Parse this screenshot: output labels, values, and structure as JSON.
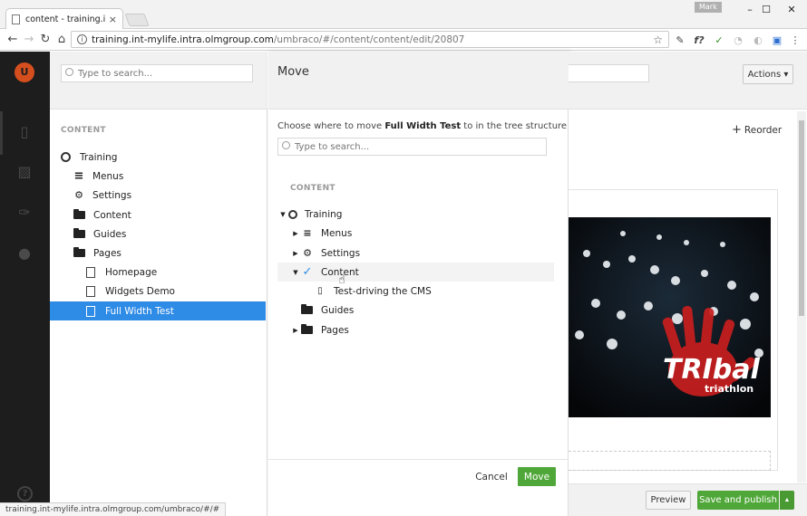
{
  "browser": {
    "tab_title": "content - training.int-my",
    "tab_close": "×",
    "user": "Mark",
    "controls": {
      "minimize": "–",
      "maximize": "☐",
      "close": "✕"
    },
    "nav": {
      "back": "←",
      "forward": "→",
      "reload": "↻",
      "home": "⌂"
    },
    "url_host": "training.int-mylife.intra.olmgroup.com",
    "url_path": "/umbraco/#/content/content/edit/20807",
    "star": "☆",
    "extensions": [
      "✎",
      "f?",
      "✓",
      "◔",
      "◐",
      "▣",
      "⋮"
    ],
    "status_url": "training.int-mylife.intra.olmgroup.com/umbraco/#/#"
  },
  "left_nav": {
    "logo": "U",
    "icons": [
      "content-icon",
      "media-icon",
      "settings-icon",
      "users-icon"
    ],
    "glyphs": [
      "▯",
      "▨",
      "✑",
      "●"
    ],
    "help": "?"
  },
  "tree": {
    "search_placeholder": "Type to search...",
    "section": "CONTENT",
    "items": [
      {
        "label": "Training",
        "icon": "globe"
      },
      {
        "label": "Menus",
        "icon": "menu"
      },
      {
        "label": "Settings",
        "icon": "gear"
      },
      {
        "label": "Content",
        "icon": "folder"
      },
      {
        "label": "Guides",
        "icon": "folder"
      },
      {
        "label": "Pages",
        "icon": "folder"
      },
      {
        "label": "Homepage",
        "icon": "document"
      },
      {
        "label": "Widgets Demo",
        "icon": "document"
      },
      {
        "label": "Full Width Test",
        "icon": "document",
        "active": true
      }
    ]
  },
  "move_dialog": {
    "title": "Move",
    "desc_prefix": "Choose where to move ",
    "desc_node": "Full Width Test",
    "desc_suffix": " to in the tree structure below",
    "search_placeholder": "Type to search...",
    "section": "CONTENT",
    "items": [
      {
        "label": "Training",
        "caret": "▼"
      },
      {
        "label": "Menus",
        "caret": "▶"
      },
      {
        "label": "Settings",
        "caret": "▶"
      },
      {
        "label": "Content",
        "caret": "▼",
        "selected": true
      },
      {
        "label": "Test-driving the CMS",
        "caret": ""
      },
      {
        "label": "Guides",
        "caret": ""
      },
      {
        "label": "Pages",
        "caret": "▶"
      }
    ],
    "cancel_label": "Cancel",
    "move_label": "Move"
  },
  "editor": {
    "actions_label": "Actions ▾",
    "reorder_label": "Reorder",
    "preview_label": "Preview",
    "publish_label": "Save and publish",
    "publish_caret": "▲",
    "image_text": "TRIbal",
    "image_subtext": "triathlon"
  },
  "colors": {
    "accent": "#2e8be6",
    "green": "#50a739",
    "nav_bg": "#1d1d1d",
    "logo": "#d54e1e"
  }
}
